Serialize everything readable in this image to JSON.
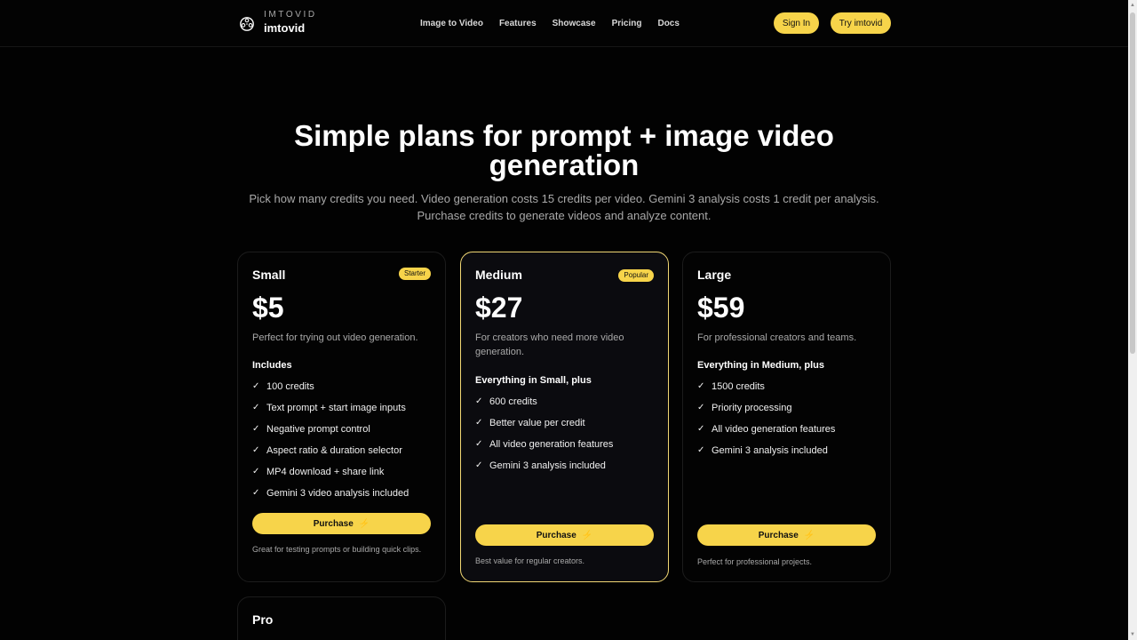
{
  "header": {
    "brand_small": "IMTOVID",
    "brand_big": "imtovid",
    "nav": [
      "Image to Video",
      "Features",
      "Showcase",
      "Pricing",
      "Docs"
    ],
    "sign_in": "Sign In",
    "try": "Try imtovid"
  },
  "hero": {
    "title": "Simple plans for prompt + image video generation",
    "subtitle": "Pick how many credits you need. Video generation costs 15 credits per video. Gemini 3 analysis costs 1 credit per analysis. Purchase credits to generate videos and analyze content."
  },
  "plans": [
    {
      "name": "Small",
      "badge": "Starter",
      "price": "$5",
      "description": "Perfect for trying out video generation.",
      "includes_label": "Includes",
      "features": [
        "100 credits",
        "Text prompt + start image inputs",
        "Negative prompt control",
        "Aspect ratio & duration selector",
        "MP4 download + share link",
        "Gemini 3 video analysis included"
      ],
      "button": "Purchase",
      "footnote": "Great for testing prompts or building quick clips."
    },
    {
      "name": "Medium",
      "badge": "Popular",
      "price": "$27",
      "description": "For creators who need more video generation.",
      "includes_label": "Everything in Small, plus",
      "features": [
        "600 credits",
        "Better value per credit",
        "All video generation features",
        "Gemini 3 analysis included"
      ],
      "button": "Purchase",
      "footnote": "Best value for regular creators."
    },
    {
      "name": "Large",
      "badge": "",
      "price": "$59",
      "description": "For professional creators and teams.",
      "includes_label": "Everything in Medium, plus",
      "features": [
        "1500 credits",
        "Priority processing",
        "All video generation features",
        "Gemini 3 analysis included"
      ],
      "button": "Purchase",
      "footnote": "Perfect for professional projects."
    },
    {
      "name": "Pro"
    }
  ],
  "colors": {
    "accent": "#f7d44a",
    "background": "#020202"
  },
  "icons": {
    "logo": "film-reel-icon",
    "check": "check-icon",
    "bolt": "lightning-bolt-icon"
  }
}
